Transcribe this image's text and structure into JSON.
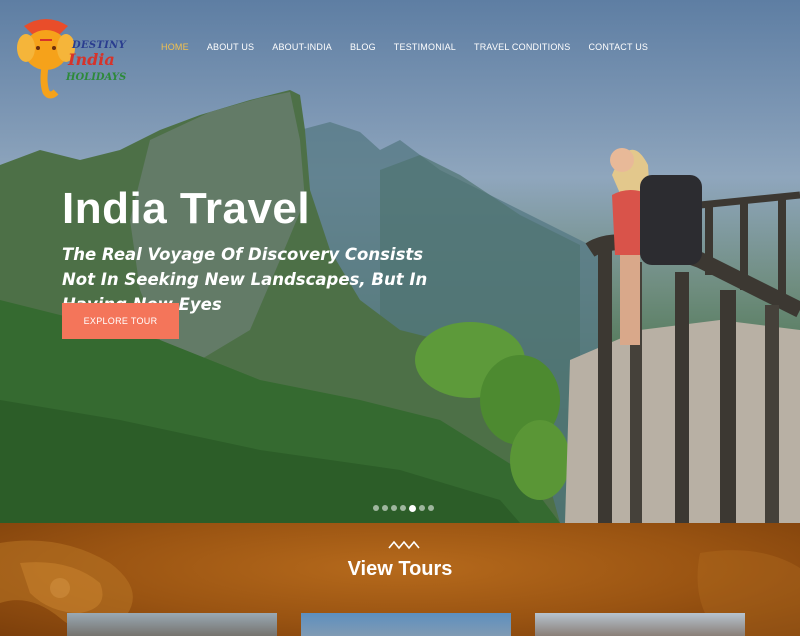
{
  "brand": {
    "line1": "DESTINY",
    "line2": "India",
    "line3": "HOLIDAYS"
  },
  "nav": {
    "items": [
      {
        "label": "HOME",
        "active": true
      },
      {
        "label": "ABOUT US",
        "active": false
      },
      {
        "label": "ABOUT-INDIA",
        "active": false
      },
      {
        "label": "BLOG",
        "active": false
      },
      {
        "label": "TESTIMONIAL",
        "active": false
      },
      {
        "label": "TRAVEL CONDITIONS",
        "active": false
      },
      {
        "label": "CONTACT US",
        "active": false
      }
    ]
  },
  "hero": {
    "title": "India Travel",
    "subtitle": "The Real Voyage Of Discovery Consists Not In Seeking New Landscapes, But In Having New Eyes",
    "button": "EXPLORE TOUR",
    "slides_total": 7,
    "active_slide": 5
  },
  "tours": {
    "title": "View Tours"
  },
  "colors": {
    "accent": "#f4755a",
    "nav_active": "#f2c14e",
    "section_bg": "#9a5412"
  }
}
